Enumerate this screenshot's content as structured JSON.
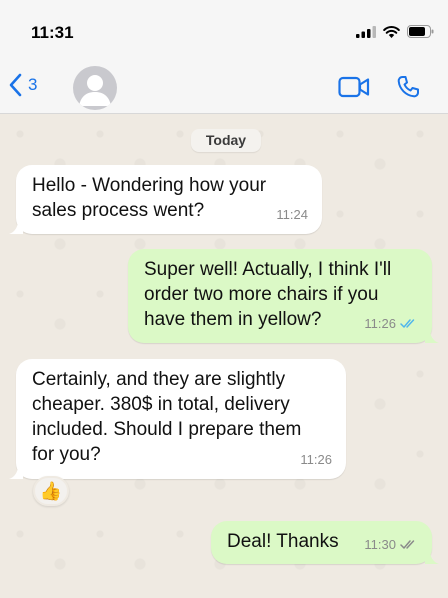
{
  "status": {
    "time": "11:31",
    "icons": [
      "signal-icon",
      "wifi-icon",
      "battery-icon"
    ]
  },
  "nav": {
    "back_count": "3",
    "actions": [
      "video-call-icon",
      "phone-call-icon"
    ],
    "accent": "#1a73e8"
  },
  "chat": {
    "date_label": "Today",
    "messages": [
      {
        "direction": "incoming",
        "text": "Hello - Wondering how your\nsales process went?",
        "time": "11:24"
      },
      {
        "direction": "outgoing",
        "text": "Super well! Actually, I think I'll\norder two more chairs if you\nhave them in yellow?",
        "time": "11:26",
        "status": "read"
      },
      {
        "direction": "incoming",
        "text": "Certainly, and they are slightly\ncheaper. 380$ in total, delivery\nincluded. Should I prepare them\nfor you?",
        "time": "11:26",
        "reaction": "👍"
      },
      {
        "direction": "outgoing",
        "text": "Deal! Thanks",
        "time": "11:30",
        "status": "delivered"
      }
    ],
    "colors": {
      "incoming": "#ffffff",
      "outgoing": "#dbf9c6",
      "read_ticks": "#4fb6ec",
      "delivered_ticks": "#8a8a8a"
    }
  }
}
